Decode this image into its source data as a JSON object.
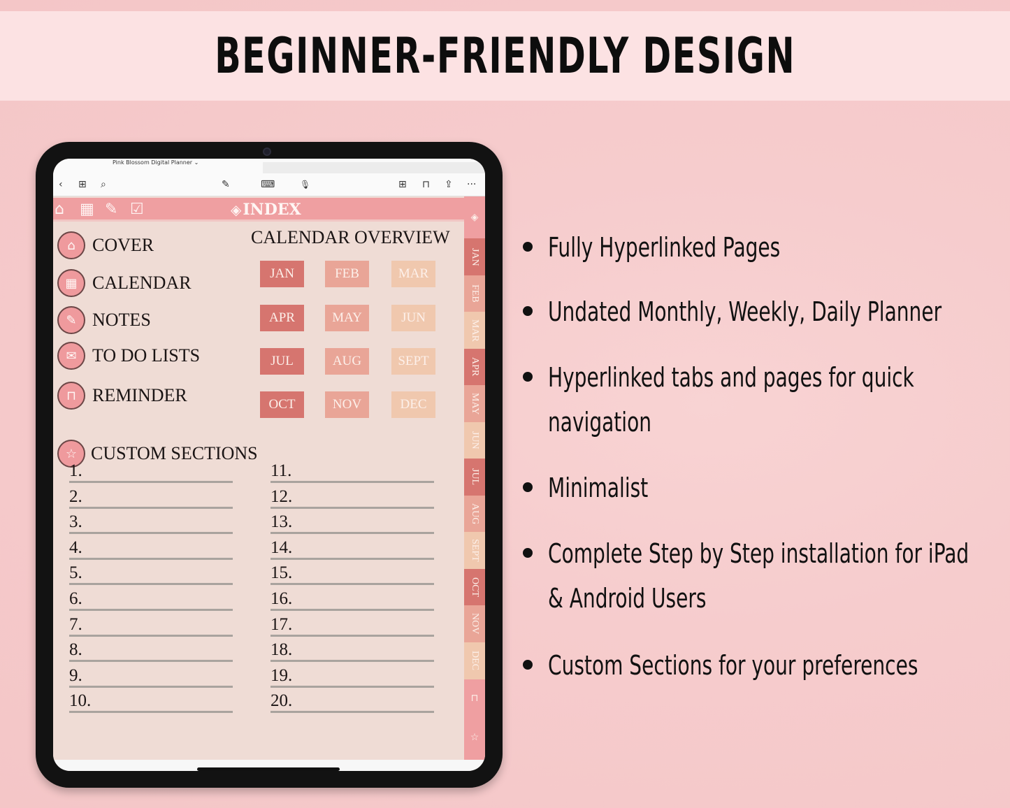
{
  "banner": {
    "title": "BEGINNER-FRIENDLY DESIGN"
  },
  "app": {
    "document_title": "Pink Blossom Digital Planner ⌄",
    "toolbar": {
      "back": "‹",
      "grid": "⊞",
      "search": "⌕",
      "pen": "✎",
      "keyboard": "⌨",
      "mic": "🎙",
      "add_page": "⊞",
      "bookmark": "⊓",
      "share": "⇪",
      "more": "···"
    }
  },
  "planner": {
    "index_title": "INDEX",
    "header_icons": [
      "home",
      "calendar",
      "pen",
      "todo"
    ],
    "nav": [
      {
        "label": "COVER",
        "icon": "home-icon"
      },
      {
        "label": "CALENDAR",
        "icon": "calendar-icon"
      },
      {
        "label": "NOTES",
        "icon": "pen-icon"
      },
      {
        "label": "TO DO LISTS",
        "icon": "todo-icon"
      },
      {
        "label": "REMINDER",
        "icon": "bookmark-icon"
      }
    ],
    "calendar_title": "CALENDAR OVERVIEW",
    "months": [
      "JAN",
      "FEB",
      "MAR",
      "APR",
      "MAY",
      "JUN",
      "JUL",
      "AUG",
      "SEPT",
      "OCT",
      "NOV",
      "DEC"
    ],
    "month_colors": {
      "col1": "#d6756f",
      "col2": "#e9a597",
      "col3": "#f0c8ae"
    },
    "custom_sections_title": "CUSTOM SECTIONS",
    "custom_sections": [
      "1.",
      "2.",
      "3.",
      "4.",
      "5.",
      "6.",
      "7.",
      "8.",
      "9.",
      "10.",
      "11.",
      "12.",
      "13.",
      "14.",
      "15.",
      "16.",
      "17.",
      "18.",
      "19.",
      "20."
    ],
    "side_tabs": [
      "JAN",
      "FEB",
      "MAR",
      "APR",
      "MAY",
      "JUN",
      "JUL",
      "AUG",
      "SEPT",
      "OCT",
      "NOV",
      "DEC"
    ],
    "accent_color": "#ef9fa1"
  },
  "features": [
    "Fully Hyperlinked Pages",
    "Undated Monthly, Weekly, Daily Planner",
    "Hyperlinked tabs and pages for quick navigation",
    "Minimalist",
    "Complete Step by Step installation for iPad & Android Users",
    "Custom Sections for your preferences"
  ]
}
